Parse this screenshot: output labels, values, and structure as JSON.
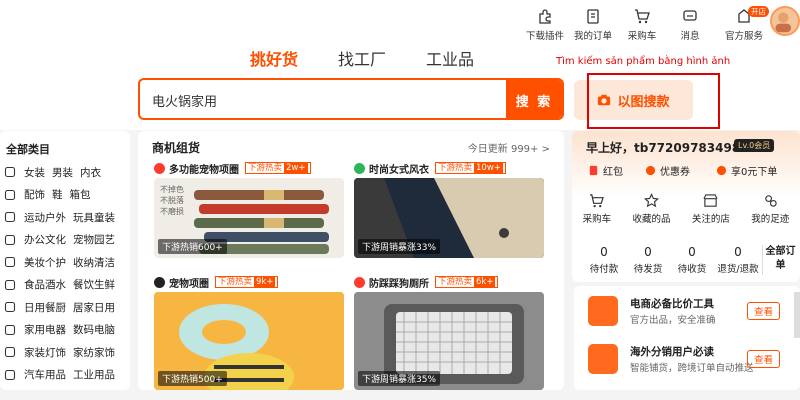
{
  "top_nav": [
    {
      "label": "下载插件",
      "icon": "puzzle-icon"
    },
    {
      "label": "我的订单",
      "icon": "order-icon"
    },
    {
      "label": "采购车",
      "icon": "cart-icon"
    },
    {
      "label": "消息",
      "icon": "message-icon"
    },
    {
      "label": "官方服务",
      "icon": "service-icon",
      "badge": "开店"
    }
  ],
  "tabs": [
    "挑好货",
    "找工厂",
    "工业品"
  ],
  "annotation": "Tìm kiếm sản phẩm bằng hình ảnh",
  "search": {
    "value": "电火锅家用",
    "button": "搜 索"
  },
  "image_search": {
    "label": "以图搜款",
    "icon": "camera-icon"
  },
  "categories": {
    "title": "全部类目",
    "rows": [
      {
        "icon": "clothing-icon",
        "items": [
          "女装",
          "男装",
          "内衣"
        ]
      },
      {
        "icon": "accessory-icon",
        "items": [
          "配饰",
          "鞋",
          "箱包"
        ]
      },
      {
        "icon": "sports-icon",
        "items": [
          "运动户外",
          "玩具童装"
        ]
      },
      {
        "icon": "office-icon",
        "items": [
          "办公文化",
          "宠物园艺"
        ]
      },
      {
        "icon": "beauty-icon",
        "items": [
          "美妆个护",
          "收纳清洁"
        ]
      },
      {
        "icon": "food-icon",
        "items": [
          "食品酒水",
          "餐饮生鲜"
        ]
      },
      {
        "icon": "kitchen-icon",
        "items": [
          "日用餐厨",
          "居家日用"
        ]
      },
      {
        "icon": "appliance-icon",
        "items": [
          "家用电器",
          "数码电脑"
        ]
      },
      {
        "icon": "lamp-icon",
        "items": [
          "家装灯饰",
          "家纺家饰"
        ]
      },
      {
        "icon": "car-icon",
        "items": [
          "汽车用品",
          "工业用品"
        ]
      }
    ]
  },
  "hot": {
    "title": "商机组货",
    "update": "今日更新 999+",
    "tag_label": "下游热卖",
    "cards": [
      {
        "title": "多功能宠物项圈",
        "tag_value": "2w+",
        "caption": "下游热销600+",
        "dot_color": "#ff3b30",
        "overlay": [
          "不掉色",
          "不脱落",
          "不磨损"
        ]
      },
      {
        "title": "时尚女式风衣",
        "tag_value": "10w+",
        "caption": "下游周销暴涨33%",
        "dot_color": "#2fb55a",
        "overlay": []
      },
      {
        "title": "宠物项圈",
        "tag_value": "9k+",
        "caption": "下游热销500+",
        "dot_color": "#222222",
        "overlay": []
      },
      {
        "title": "防踩踩狗厕所",
        "tag_value": "6k+",
        "caption": "下游周销暴涨35%",
        "dot_color": "#ff3b30",
        "overlay": []
      }
    ]
  },
  "user": {
    "greeting": "早上好，tb772097834983",
    "level": "Lv.0会员",
    "perks": [
      {
        "label": "红包",
        "icon": "redpacket-icon"
      },
      {
        "label": "优惠券",
        "icon": "coupon-icon"
      },
      {
        "label": "享0元下单",
        "icon": "yen-icon"
      }
    ],
    "quick_links": [
      {
        "label": "采购车",
        "icon": "cart-icon"
      },
      {
        "label": "收藏的品",
        "icon": "star-icon"
      },
      {
        "label": "关注的店",
        "icon": "shop-icon"
      },
      {
        "label": "我的足迹",
        "icon": "footprint-icon"
      }
    ],
    "orders": [
      {
        "count": "0",
        "label": "待付款"
      },
      {
        "count": "0",
        "label": "待发货"
      },
      {
        "count": "0",
        "label": "待收货"
      },
      {
        "count": "0",
        "label": "退货/退款"
      }
    ],
    "all_orders": "全部订单"
  },
  "tools": [
    {
      "title": "电商必备比价工具",
      "desc": "官方出品，安全准确",
      "action": "查看"
    },
    {
      "title": "海外分销用户必读",
      "desc": "智能铺货，跨境订单自动推送",
      "action": "查看"
    }
  ],
  "colors": {
    "accent": "#ff5000",
    "annotation": "#e00000"
  }
}
